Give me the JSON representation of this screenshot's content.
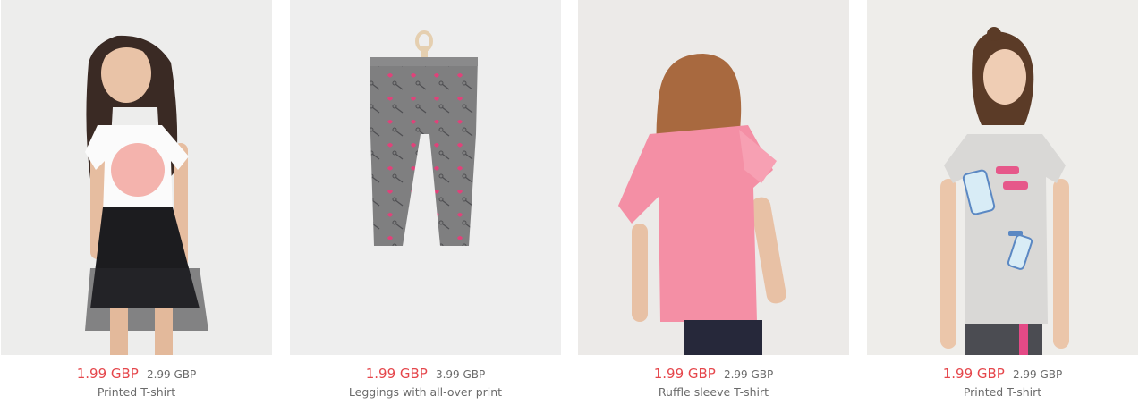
{
  "currency": "GBP",
  "products": [
    {
      "name": "Printed T-shirt",
      "price": "1.99 GBP",
      "old_price": "2.99 GBP"
    },
    {
      "name": "Leggings with all-over print",
      "price": "1.99 GBP",
      "old_price": "3.99 GBP"
    },
    {
      "name": "Ruffle sleeve T-shirt",
      "price": "1.99 GBP",
      "old_price": "2.99 GBP"
    },
    {
      "name": "Printed T-shirt",
      "price": "1.99 GBP",
      "old_price": "2.99 GBP"
    }
  ],
  "colors": {
    "sale_price": "#e5464b",
    "text_muted": "#6b6b6b",
    "photo_bg": "#eeeeee"
  }
}
